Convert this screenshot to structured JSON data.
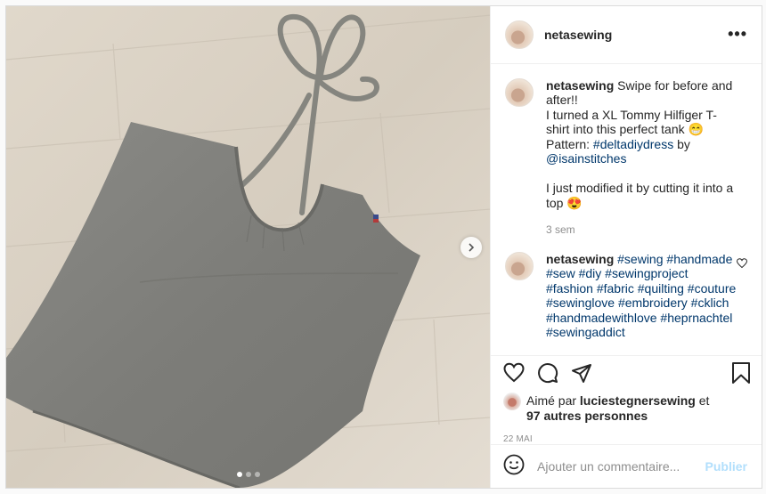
{
  "header": {
    "username": "netasewing",
    "more_label": "•••"
  },
  "caption": {
    "username": "netasewing",
    "line1": "Swipe for before and after!!",
    "line2": "I turned a XL Tommy Hilfiger T-shirt into this perfect tank 😁",
    "pattern_label": "Pattern:",
    "pattern_tag": "#deltadiydress",
    "by_label": "by",
    "pattern_author": "@isainstitches",
    "line3": "I just modified it by cutting it into a top 😍",
    "time": "3 sem"
  },
  "hashtag_comment": {
    "username": "netasewing",
    "tags": [
      "#sewing",
      "#handmade",
      "#sew",
      "#diy",
      "#sewingproject",
      "#fashion",
      "#fabric",
      "#quilting",
      "#couture",
      "#sewinglove",
      "#embroidery",
      "#cklich",
      "#handmadewithlove",
      "#heprnachtel",
      "#sewingaddict"
    ]
  },
  "likes": {
    "prefix": "Aimé par",
    "user": "luciestegnersewing",
    "connector": "et",
    "others": "97 autres personnes"
  },
  "date": "22 MAI",
  "comment_box": {
    "placeholder": "Ajouter un commentaire...",
    "publish": "Publier"
  },
  "carousel": {
    "count": 3,
    "active": 0
  },
  "colors": {
    "link": "#00376b",
    "muted": "#8e8e8e",
    "publish": "#b2dffc"
  }
}
